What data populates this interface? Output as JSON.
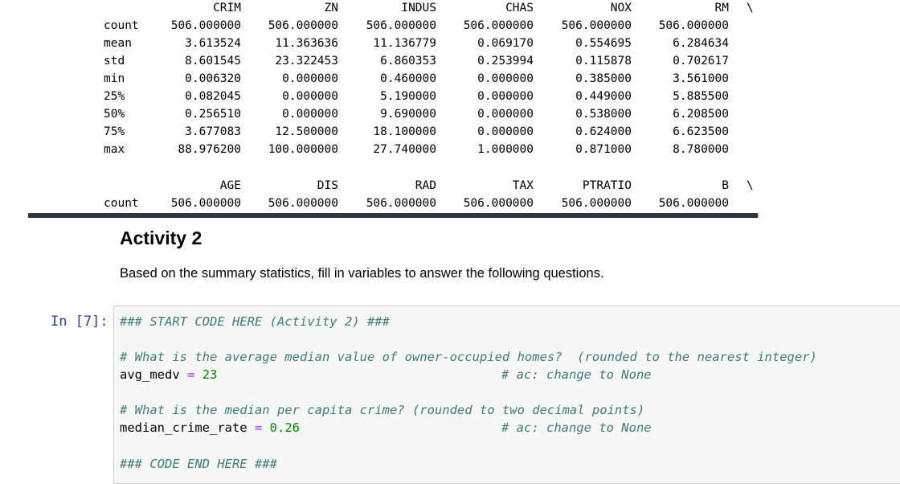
{
  "output": {
    "table1": {
      "headers": [
        "CRIM",
        "ZN",
        "INDUS",
        "CHAS",
        "NOX",
        "RM"
      ],
      "continuation": "\\",
      "rows": [
        {
          "label": "count",
          "values": [
            "506.000000",
            "506.000000",
            "506.000000",
            "506.000000",
            "506.000000",
            "506.000000"
          ]
        },
        {
          "label": "mean",
          "values": [
            "3.613524",
            "11.363636",
            "11.136779",
            "0.069170",
            "0.554695",
            "6.284634"
          ]
        },
        {
          "label": "std",
          "values": [
            "8.601545",
            "23.322453",
            "6.860353",
            "0.253994",
            "0.115878",
            "0.702617"
          ]
        },
        {
          "label": "min",
          "values": [
            "0.006320",
            "0.000000",
            "0.460000",
            "0.000000",
            "0.385000",
            "3.561000"
          ]
        },
        {
          "label": "25%",
          "values": [
            "0.082045",
            "0.000000",
            "5.190000",
            "0.000000",
            "0.449000",
            "5.885500"
          ]
        },
        {
          "label": "50%",
          "values": [
            "0.256510",
            "0.000000",
            "9.690000",
            "0.000000",
            "0.538000",
            "6.208500"
          ]
        },
        {
          "label": "75%",
          "values": [
            "3.677083",
            "12.500000",
            "18.100000",
            "0.000000",
            "0.624000",
            "6.623500"
          ]
        },
        {
          "label": "max",
          "values": [
            "88.976200",
            "100.000000",
            "27.740000",
            "1.000000",
            "0.871000",
            "8.780000"
          ]
        }
      ]
    },
    "table2": {
      "headers": [
        "AGE",
        "DIS",
        "RAD",
        "TAX",
        "PTRATIO",
        "B"
      ],
      "continuation": "\\",
      "rows": [
        {
          "label": "count",
          "values": [
            "506.000000",
            "506.000000",
            "506.000000",
            "506.000000",
            "506.000000",
            "506.000000"
          ]
        }
      ]
    }
  },
  "markdown": {
    "title": "Activity 2",
    "text": "Based on the summary statistics, fill in variables to answer the following questions."
  },
  "code_cell": {
    "prompt": "In [7]:",
    "line_start": "### START CODE HERE (Activity 2) ###",
    "q1_comment": "# What is the average median value of owner-occupied homes?  (rounded to the nearest integer)",
    "q1_var": "avg_medv",
    "q1_eq": "=",
    "q1_val": "23",
    "q1_note": "# ac: change to None",
    "q2_comment": "# What is the median per capita crime? (rounded to two decimal points)",
    "q2_var": "median_crime_rate",
    "q2_eq": "=",
    "q2_val": "0.26",
    "q2_note": "# ac: change to None",
    "line_end": "### CODE END HERE ###"
  }
}
